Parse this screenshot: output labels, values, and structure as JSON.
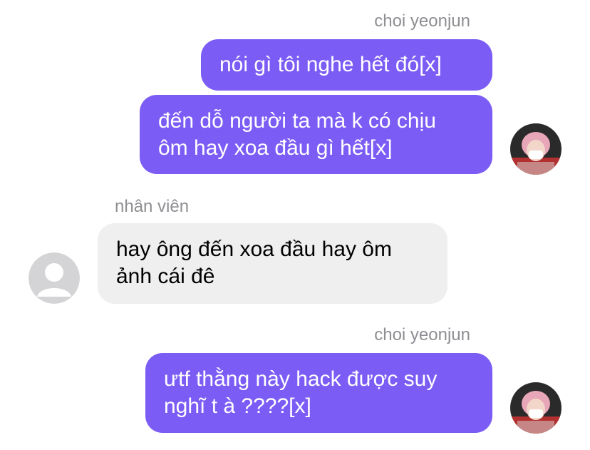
{
  "messages": [
    {
      "sender": "choi yeonjun"
    },
    {
      "lines": [
        "nói gì tôi nghe hết đó[x]"
      ]
    },
    {
      "lines": [
        "đến dỗ người ta mà k có chịu",
        "ôm hay xoa đầu gì hết[x]"
      ]
    },
    {
      "sender": "nhân viên"
    },
    {
      "lines": [
        "hay ông đến xoa đầu hay ôm",
        "ảnh cái đê"
      ]
    },
    {
      "sender": "choi yeonjun"
    },
    {
      "lines": [
        "ưtf thằng này hack được suy",
        "nghĩ t à ????[x]"
      ]
    }
  ],
  "colors": {
    "outgoing_bubble": "#7b5cf5",
    "incoming_bubble": "#efefef",
    "sender_label": "#8e8e93"
  }
}
